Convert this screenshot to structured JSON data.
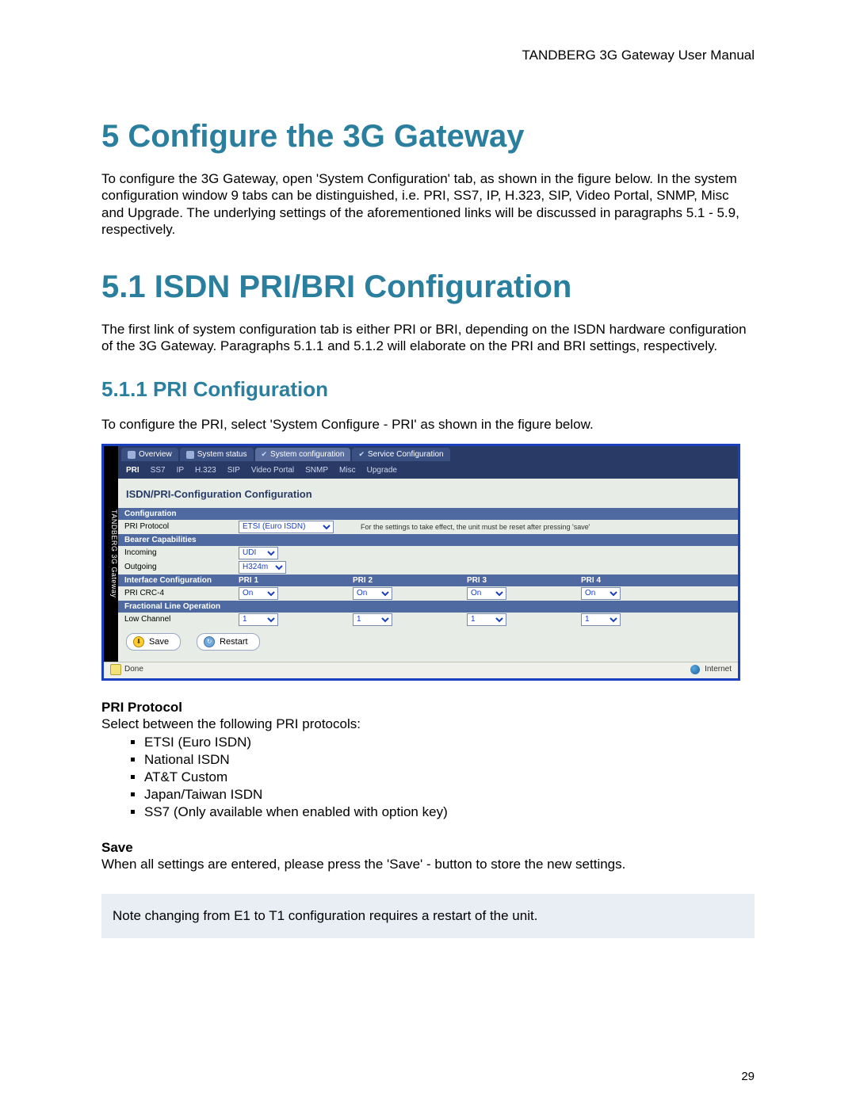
{
  "doc_header": "TANDBERG 3G Gateway User Manual",
  "heading5": "5 Configure the 3G Gateway",
  "intro5": "To configure the 3G Gateway, open 'System Configuration' tab, as shown in the figure below. In the system configuration window 9 tabs can be distinguished, i.e. PRI, SS7, IP, H.323, SIP, Video Portal, SNMP, Misc and Upgrade. The underlying settings of the aforementioned links will be discussed in paragraphs 5.1 - 5.9, respectively.",
  "heading51": "5.1 ISDN PRI/BRI Configuration",
  "intro51": "The first link of system configuration tab is either PRI or BRI, depending on the ISDN hardware configuration of the 3G Gateway. Paragraphs 5.1.1 and 5.1.2 will elaborate on the PRI and BRI settings, respectively.",
  "heading511": "5.1.1  PRI Configuration",
  "intro511": "To configure the PRI, select 'System Configure - PRI' as shown in the figure below.",
  "figure": {
    "brand_strip": "TANDBERG 3G Gateway",
    "top_tabs": [
      "Overview",
      "System status",
      "System configuration",
      "Service Configuration"
    ],
    "sub_tabs": [
      "PRI",
      "SS7",
      "IP",
      "H.323",
      "SIP",
      "Video Portal",
      "SNMP",
      "Misc",
      "Upgrade"
    ],
    "panel_title": "ISDN/PRI-Configuration Configuration",
    "sections": {
      "config": "Configuration",
      "bearer": "Bearer Capabilities",
      "interface": "Interface Configuration",
      "fractional": "Fractional Line Operation"
    },
    "rows": {
      "pri_protocol_label": "PRI Protocol",
      "pri_protocol_value": "ETSI (Euro ISDN)",
      "pri_protocol_hint": "For the settings to take effect, the unit must be reset after pressing 'save'",
      "incoming_label": "Incoming",
      "incoming_value": "UDI",
      "outgoing_label": "Outgoing",
      "outgoing_value": "H324m",
      "interface_cols": [
        "PRI 1",
        "PRI 2",
        "PRI 3",
        "PRI 4"
      ],
      "crc_label": "PRI CRC-4",
      "crc_value": "On",
      "low_channel_label": "Low Channel",
      "low_channel_value": "1"
    },
    "buttons": {
      "save": "Save",
      "restart": "Restart"
    },
    "status": {
      "done": "Done",
      "internet": "Internet"
    }
  },
  "pri_protocol": {
    "label": "PRI Protocol",
    "intro": "Select between the following PRI protocols:",
    "items": [
      "ETSI (Euro ISDN)",
      "National ISDN",
      "AT&T Custom",
      "Japan/Taiwan ISDN",
      "SS7 (Only available when enabled with option key)"
    ]
  },
  "save": {
    "label": "Save",
    "text": "When all settings are entered, please press the 'Save' - button to store the new settings."
  },
  "note": "Note changing from E1 to T1 configuration requires a restart of the unit.",
  "page_number": "29"
}
